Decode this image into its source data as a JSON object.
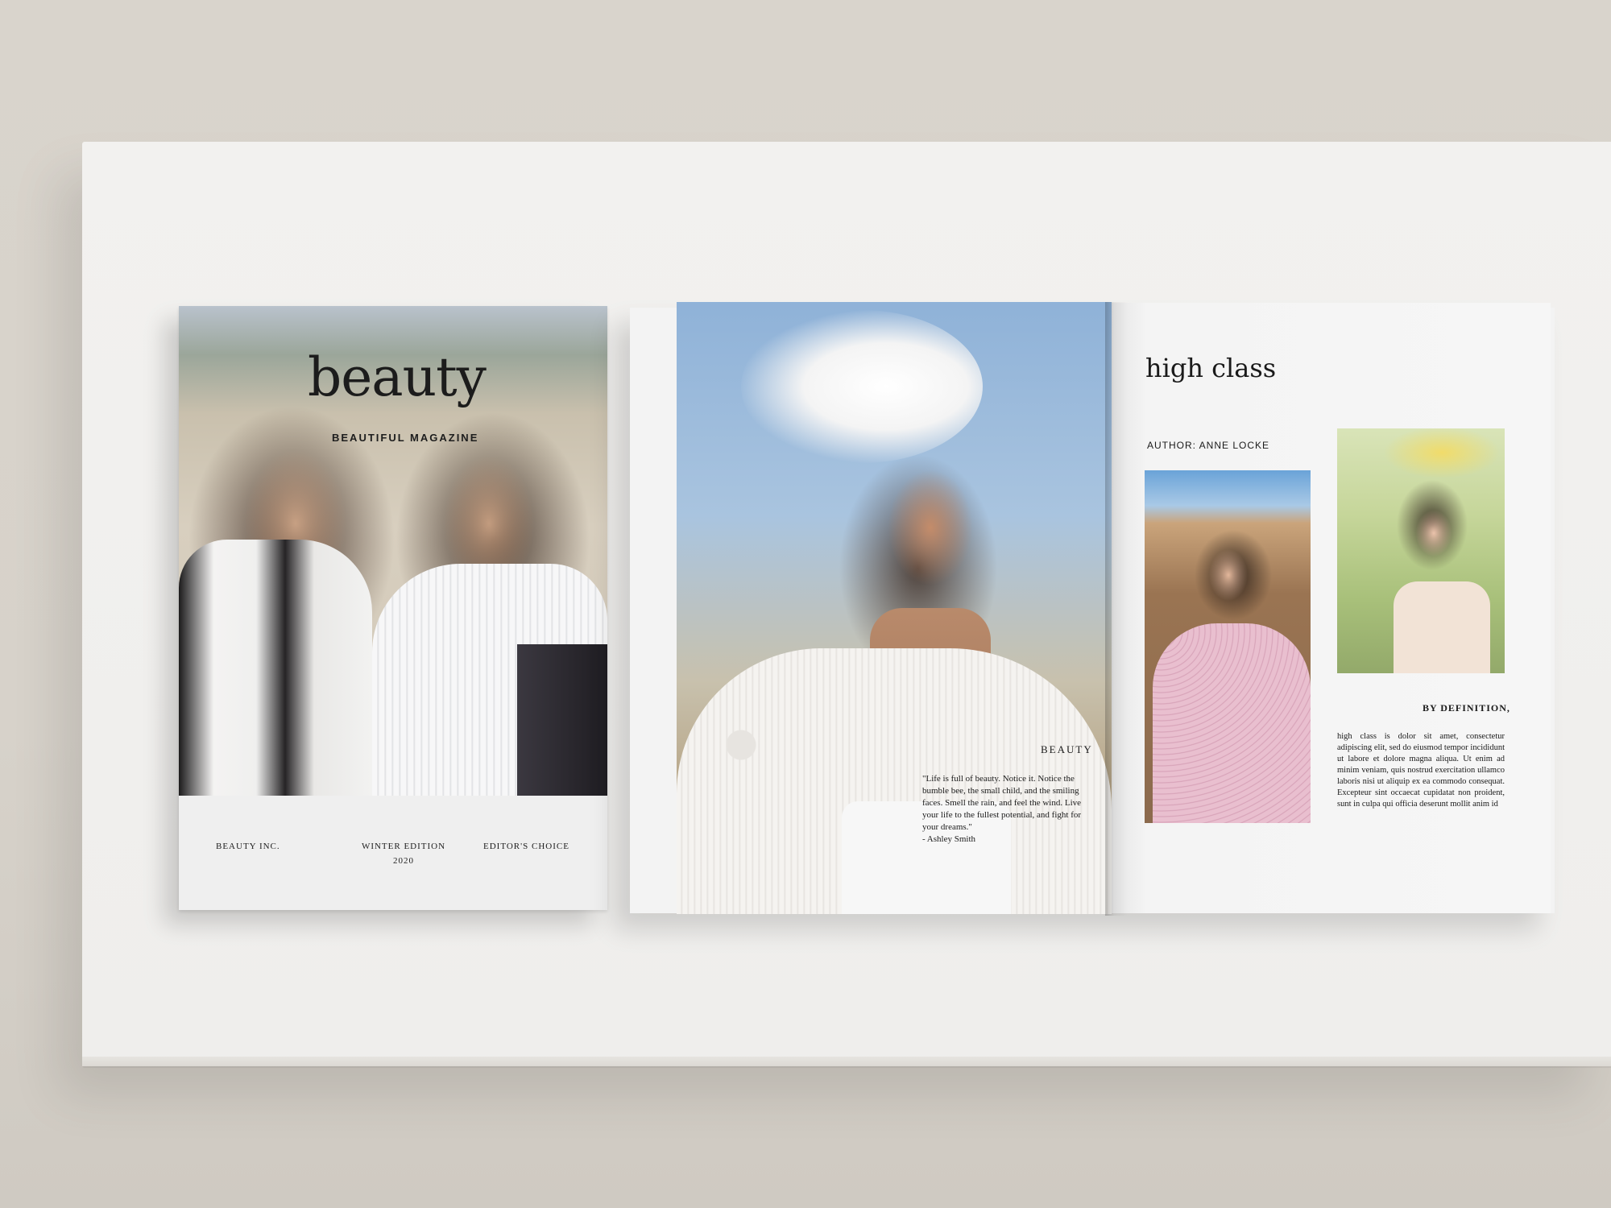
{
  "cover": {
    "title": "beauty",
    "subtitle": "BEAUTIFUL MAGAZINE",
    "footer": {
      "publisher": "BEAUTY INC.",
      "edition_line1": "WINTER EDITION",
      "edition_line2": "2020",
      "badge": "EDITOR'S CHOICE"
    }
  },
  "left_page": {
    "label": "BEAUTY",
    "quote": "\"Life is full of beauty. Notice it. Notice the bumble bee, the small child, and the smiling faces. Smell the rain, and feel the wind. Live your life to the fullest potential, and fight for your dreams.\"",
    "quote_author": "- Ashley Smith"
  },
  "right_page": {
    "title": "high class",
    "author": "AUTHOR: ANNE LOCKE",
    "section_heading": "BY DEFINITION,",
    "body": "high class is dolor sit amet, consectetur adipiscing elit, sed do eiusmod tempor incididunt ut labore et dolore magna aliqua. Ut enim ad minim veniam, quis nostrud exercitation ullamco laboris nisi ut aliquip ex ea commodo consequat. Excepteur sint occaecat cupidatat non proident, sunt in culpa qui officia deserunt mollit anim id"
  }
}
